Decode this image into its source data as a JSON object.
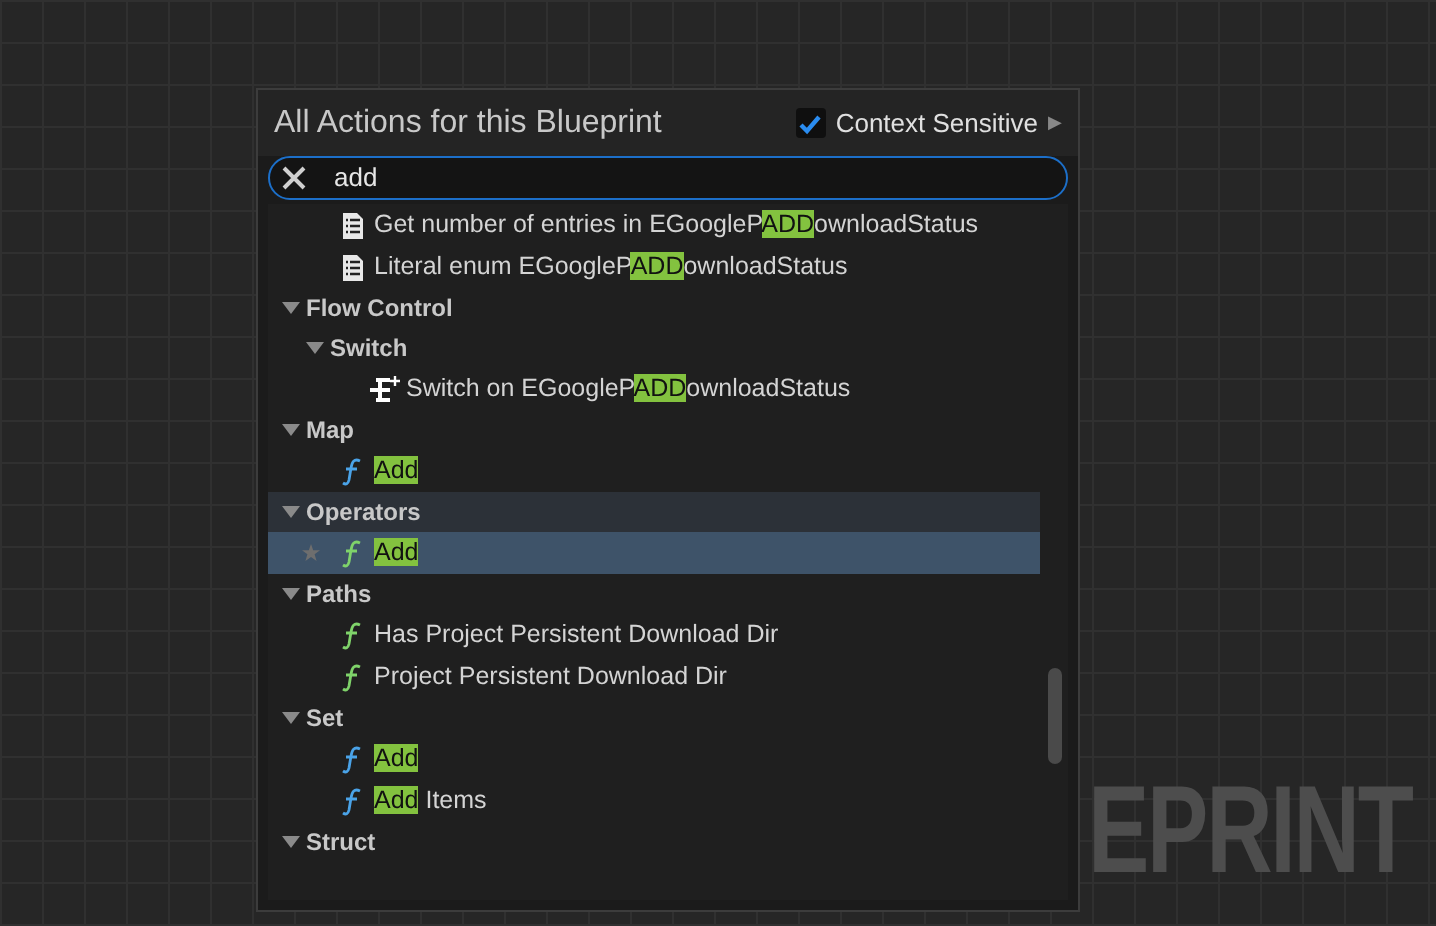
{
  "background": {
    "watermark": "EPRINT"
  },
  "panel": {
    "title": "All Actions for this Blueprint",
    "context_sensitive": {
      "label": "Context Sensitive",
      "checked": true
    },
    "expand_arrow": "▶",
    "search": {
      "value": "add"
    },
    "results": [
      {
        "children": [
          {
            "kind": "enum_entries",
            "before": "Get number of entries in EGoogleP",
            "match": "ADD",
            "after": "ownloadStatus",
            "selected": false
          },
          {
            "kind": "enum_literal",
            "before": "Literal enum EGoogleP",
            "match": "ADD",
            "after": "ownloadStatus",
            "selected": false
          }
        ]
      },
      {
        "label": "Flow Control",
        "expanded": true,
        "hovered": false,
        "children": [
          {
            "label": "Switch",
            "expanded": true,
            "hovered": false,
            "children": [
              {
                "kind": "switch",
                "before": "Switch on EGoogleP",
                "match": "ADD",
                "after": "ownloadStatus",
                "selected": false
              }
            ]
          }
        ]
      },
      {
        "label": "Map",
        "expanded": true,
        "hovered": false,
        "children": [
          {
            "kind": "function",
            "match": "Add",
            "selected": false
          }
        ]
      },
      {
        "label": "Operators",
        "expanded": true,
        "hovered": true,
        "children": [
          {
            "kind": "pure_function",
            "match": "Add",
            "selected": true
          }
        ]
      },
      {
        "label": "Paths",
        "expanded": true,
        "hovered": false,
        "children": [
          {
            "kind": "pure_function",
            "before": "Has Project Persistent Download Dir",
            "selected": false
          },
          {
            "kind": "pure_function",
            "before": "Project Persistent Download Dir",
            "selected": false
          }
        ]
      },
      {
        "label": "Set",
        "expanded": true,
        "hovered": false,
        "children": [
          {
            "kind": "function",
            "match": "Add",
            "selected": false
          },
          {
            "kind": "function",
            "match": "Add",
            "after": " Items",
            "selected": false
          }
        ]
      },
      {
        "label": "Struct",
        "expanded": true,
        "hovered": false
      }
    ]
  }
}
